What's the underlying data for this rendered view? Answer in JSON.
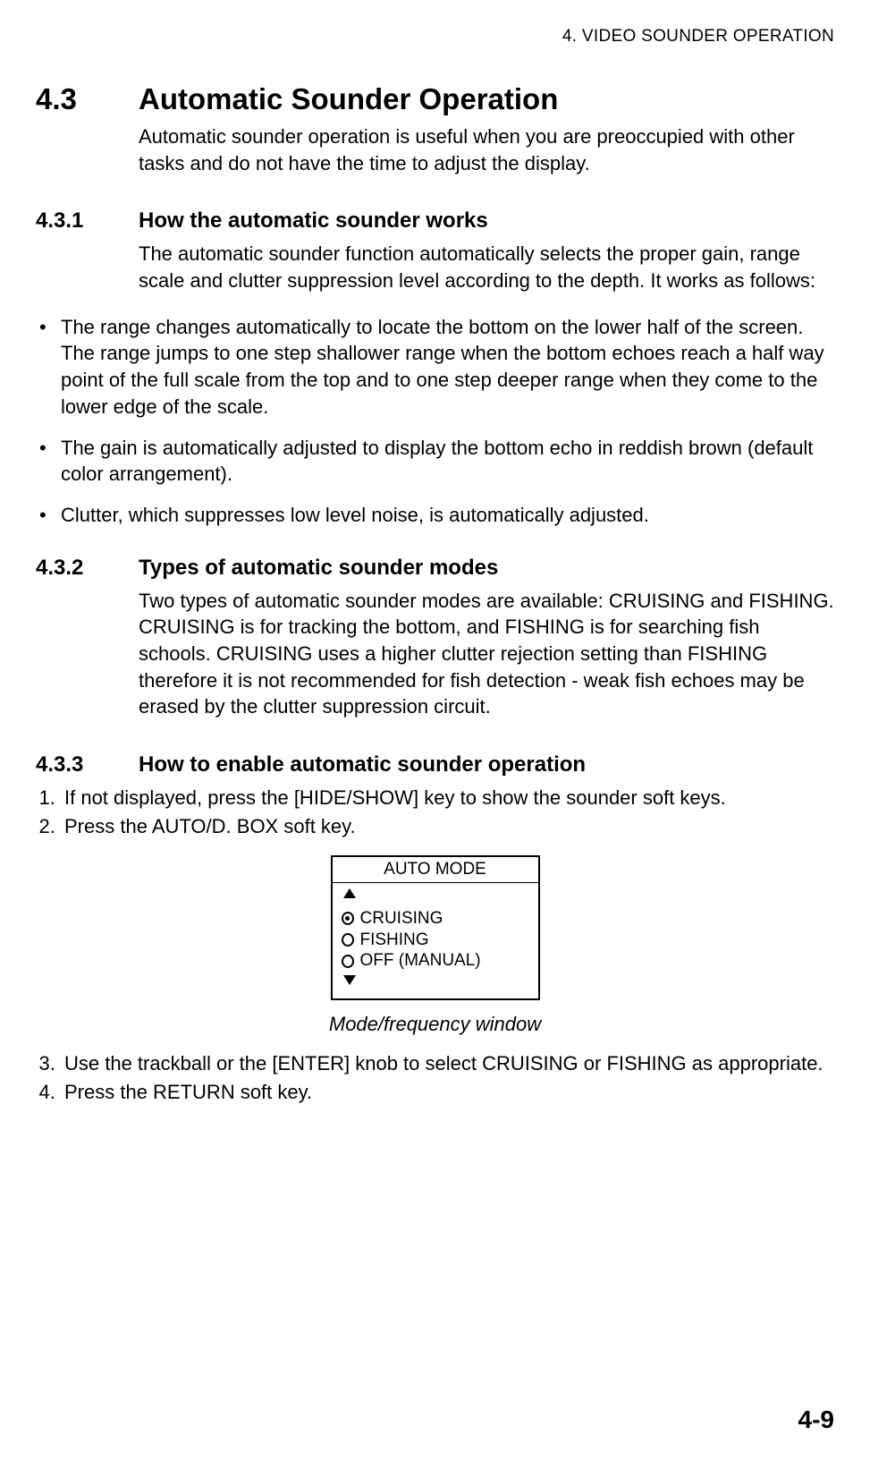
{
  "running_head": "4. VIDEO SOUNDER OPERATION",
  "section": {
    "number": "4.3",
    "title": "Automatic Sounder Operation",
    "intro": "Automatic sounder operation is useful when you are preoccupied with other tasks and do not have the time to adjust the display."
  },
  "sub1": {
    "number": "4.3.1",
    "title": "How the automatic sounder works",
    "para": "The automatic sounder function automatically selects the proper gain, range scale and clutter suppression level according to the depth. It works as follows:",
    "bullets": [
      "The range changes automatically to locate the bottom on the lower half of the screen. The range jumps to one step shallower range when the bottom echoes reach a half way point of the full scale from the top and to one step deeper range when they come to the lower edge of the scale.",
      "The gain is automatically adjusted to display the bottom echo in reddish brown (default color arrangement).",
      "Clutter, which suppresses low level noise, is automatically adjusted."
    ]
  },
  "sub2": {
    "number": "4.3.2",
    "title": "Types of automatic sounder modes",
    "para": "Two types of automatic sounder modes are available: CRUISING and FISHING. CRUISING is for tracking the bottom, and FISHING is for searching fish schools. CRUISING uses a higher clutter rejection setting than FISHING therefore it is not recommended for fish detection - weak fish echoes may be erased by the clutter suppression circuit."
  },
  "sub3": {
    "number": "4.3.3",
    "title": "How to enable automatic sounder operation",
    "steps_a": [
      "If not displayed, press the [HIDE/SHOW] key to show the sounder soft keys.",
      "Press the AUTO/D. BOX soft key."
    ],
    "figure": {
      "title": "AUTO MODE",
      "options": {
        "cruising": "CRUISING",
        "fishing": "FISHING",
        "off": "OFF (MANUAL)"
      },
      "caption": "Mode/frequency window"
    },
    "steps_b": [
      "Use the trackball or the [ENTER] knob to select CRUISING or FISHING as appropriate.",
      "Press the RETURN soft key."
    ]
  },
  "page_number": "4-9"
}
